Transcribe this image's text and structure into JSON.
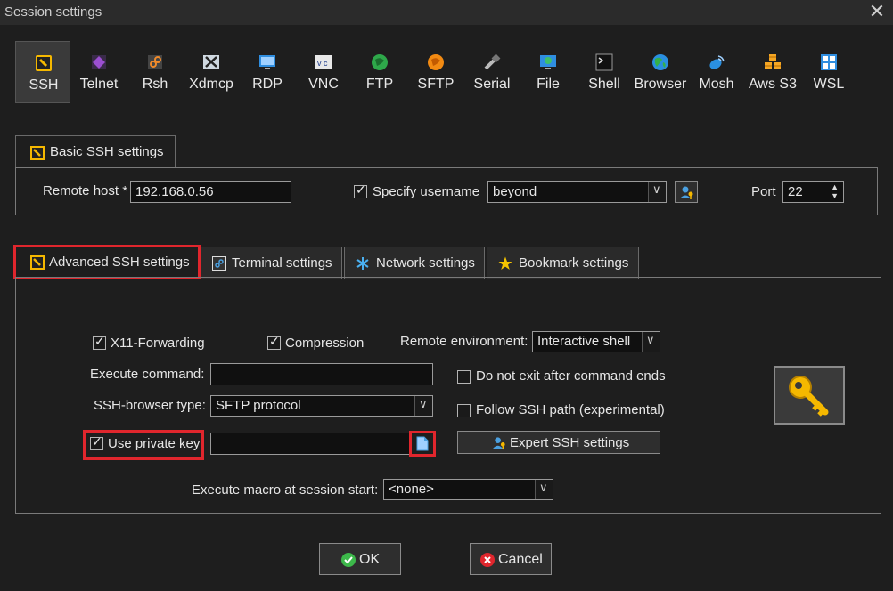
{
  "window": {
    "title": "Session settings",
    "close_glyph": "✕"
  },
  "protocols": [
    {
      "label": "SSH",
      "icon": "ssh-icon",
      "selected": true
    },
    {
      "label": "Telnet",
      "icon": "telnet-icon"
    },
    {
      "label": "Rsh",
      "icon": "rsh-icon"
    },
    {
      "label": "Xdmcp",
      "icon": "xdmcp-icon"
    },
    {
      "label": "RDP",
      "icon": "rdp-icon"
    },
    {
      "label": "VNC",
      "icon": "vnc-icon"
    },
    {
      "label": "FTP",
      "icon": "ftp-icon"
    },
    {
      "label": "SFTP",
      "icon": "sftp-icon"
    },
    {
      "label": "Serial",
      "icon": "serial-icon"
    },
    {
      "label": "File",
      "icon": "file-icon"
    },
    {
      "label": "Shell",
      "icon": "shell-icon"
    },
    {
      "label": "Browser",
      "icon": "browser-icon"
    },
    {
      "label": "Mosh",
      "icon": "mosh-icon"
    },
    {
      "label": "Aws S3",
      "icon": "aws-s3-icon"
    },
    {
      "label": "WSL",
      "icon": "wsl-icon"
    }
  ],
  "basic": {
    "tab_label": "Basic SSH settings",
    "remote_host_label": "Remote host *",
    "remote_host_value": "192.168.0.56",
    "specify_username_label": "Specify username",
    "specify_username_checked": true,
    "username_value": "beyond",
    "port_label": "Port",
    "port_value": "22"
  },
  "tabs": [
    {
      "label": "Advanced SSH settings",
      "icon": "wrench-icon",
      "active": true
    },
    {
      "label": "Terminal settings",
      "icon": "terminal-icon"
    },
    {
      "label": "Network settings",
      "icon": "network-icon"
    },
    {
      "label": "Bookmark settings",
      "icon": "star-icon"
    }
  ],
  "advanced": {
    "x11_label": "X11-Forwarding",
    "x11_checked": true,
    "compression_label": "Compression",
    "compression_checked": true,
    "remote_env_label": "Remote environment:",
    "remote_env_value": "Interactive shell",
    "execute_command_label": "Execute command:",
    "execute_command_value": "",
    "do_not_exit_label": "Do not exit after command ends",
    "do_not_exit_checked": false,
    "browser_type_label": "SSH-browser type:",
    "browser_type_value": "SFTP protocol",
    "follow_path_label": "Follow SSH path (experimental)",
    "follow_path_checked": false,
    "private_key_label": "Use private key",
    "private_key_checked": true,
    "private_key_value": "",
    "expert_button_label": "Expert SSH settings",
    "macro_label": "Execute macro at session start:",
    "macro_value": "<none>"
  },
  "buttons": {
    "ok_label": "OK",
    "cancel_label": "Cancel"
  },
  "colors": {
    "highlight": "#e0262d",
    "background": "#1e1e1e",
    "key_icon": "#f5b800"
  }
}
